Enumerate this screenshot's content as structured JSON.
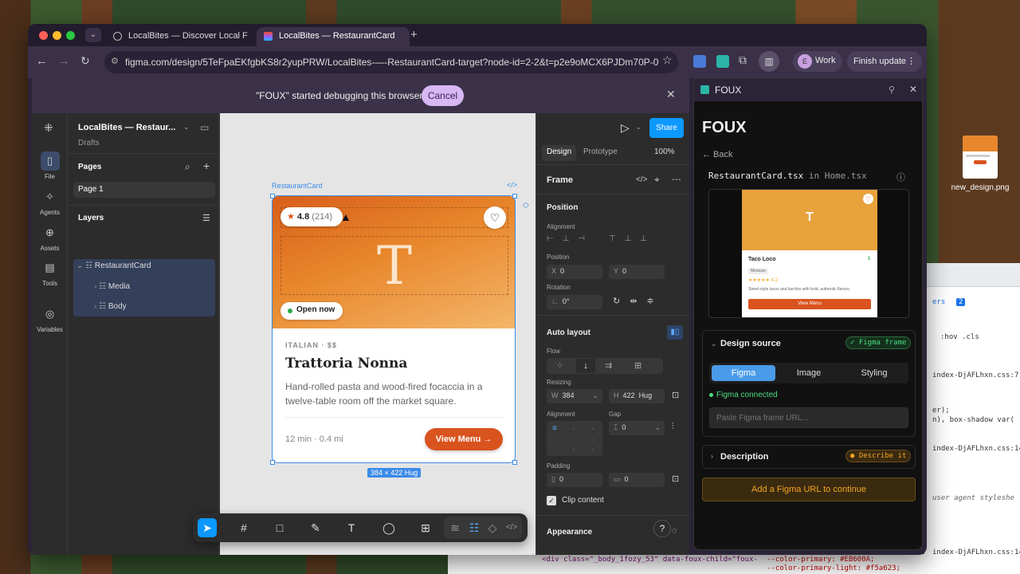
{
  "desktop": {
    "file_label": "new_design.png"
  },
  "browser": {
    "tabs": [
      {
        "label": "LocalBites — Discover Local F"
      },
      {
        "label": "LocalBites — RestaurantCard"
      }
    ],
    "url": "figma.com/design/5TeFpaEKfgbKS8r2yupPRW/LocalBites-—-RestaurantCard-target?node-id=2-2&t=p2e9oMCX6PJDm70P-0",
    "profile_label": "Work",
    "profile_initial": "E",
    "finish_update_label": "Finish update"
  },
  "debug_banner": {
    "message": "\"FOUX\" started debugging this browser",
    "cancel_label": "Cancel"
  },
  "figma": {
    "file_name": "LocalBites — Restaur...",
    "file_sub": "Drafts",
    "rail": [
      {
        "label": "File"
      },
      {
        "label": "Agents"
      },
      {
        "label": "Assets"
      },
      {
        "label": "Tools"
      },
      {
        "label": "Variables"
      }
    ],
    "pages_heading": "Pages",
    "page_item": "Page 1",
    "layers_heading": "Layers",
    "layers": [
      {
        "label": "RestaurantCard"
      },
      {
        "label": "Media"
      },
      {
        "label": "Body"
      }
    ],
    "frame_label": "RestaurantCard",
    "size_badge": "384 × 422 Hug",
    "share_label": "Share",
    "tab_design": "Design",
    "tab_prototype": "Prototype",
    "zoom": "100%",
    "frame_heading": "Frame",
    "position_heading": "Position",
    "alignment_label": "Alignment",
    "position_label": "Position",
    "x_label": "X",
    "x_value": "0",
    "y_label": "Y",
    "y_value": "0",
    "rotation_label": "Rotation",
    "rotation_value": "0°",
    "auto_layout_heading": "Auto layout",
    "flow_label": "Flow",
    "resizing_label": "Resizing",
    "w_label": "W",
    "w_value": "384",
    "h_label": "H",
    "h_value": "422",
    "h_mode": "Hug",
    "al_alignment_label": "Alignment",
    "gap_label": "Gap",
    "gap_value": "0",
    "padding_label": "Padding",
    "pad_h": "0",
    "pad_v": "0",
    "clip_label": "Clip content",
    "appearance_heading": "Appearance"
  },
  "card": {
    "rating": "4.8",
    "reviews": "(214)",
    "initial": "T",
    "status": "Open now",
    "category": "ITALIAN · $$",
    "name": "Trattoria Nonna",
    "description": "Hand-rolled pasta and wood-fired focaccia in a twelve-table room off the market square.",
    "meta": "12 min · 0.4 mi",
    "cta": "View Menu →"
  },
  "foux": {
    "panel_title": "FOUX",
    "heading": "FOUX",
    "back_label": "← Back",
    "file_name": "RestaurantCard.tsx",
    "file_context": "in Home.tsx",
    "preview": {
      "initial": "T",
      "name": "Taco Loco",
      "price": "$",
      "tag": "Mexican",
      "rating": "★★★★★ 4.2",
      "desc": "Street-style tacos and burritos with bold, authentic flavors.",
      "cta": "View Menu"
    },
    "design_source_label": "Design source",
    "design_source_badge": "✓ Figma frame",
    "tab_figma": "Figma",
    "tab_image": "Image",
    "tab_styling": "Styling",
    "connected_label": "Figma connected",
    "url_placeholder": "Paste Figma frame URL...",
    "description_label": "Description",
    "description_badge": "Describe it",
    "submit_label": "Add a Figma URL to continue"
  },
  "devtools": {
    "lines": [
      "index-DjAFLhxn.css:7",
      "er);",
      "n), box-shadow var(",
      "index-DjAFLhxn.css:14",
      "user agent styleshe",
      "index-DjAFLhxn.css:14"
    ],
    "filter_hint": ":hov .cls",
    "tab_hint": "ers",
    "badge": "2",
    "bottom_html": "<div class=\"_body_1fozy_53\" data-foux-child=\"foux-",
    "bottom_css1": "--color-primary: #EB600A;",
    "bottom_css2": "--color-primary-light: #f5a623;"
  },
  "colors": {
    "accent_orange": "#E2571A",
    "figma_blue": "#0D99FF",
    "foux_badge_green": "#4ade80",
    "foux_badge_amber": "#f5a623"
  }
}
